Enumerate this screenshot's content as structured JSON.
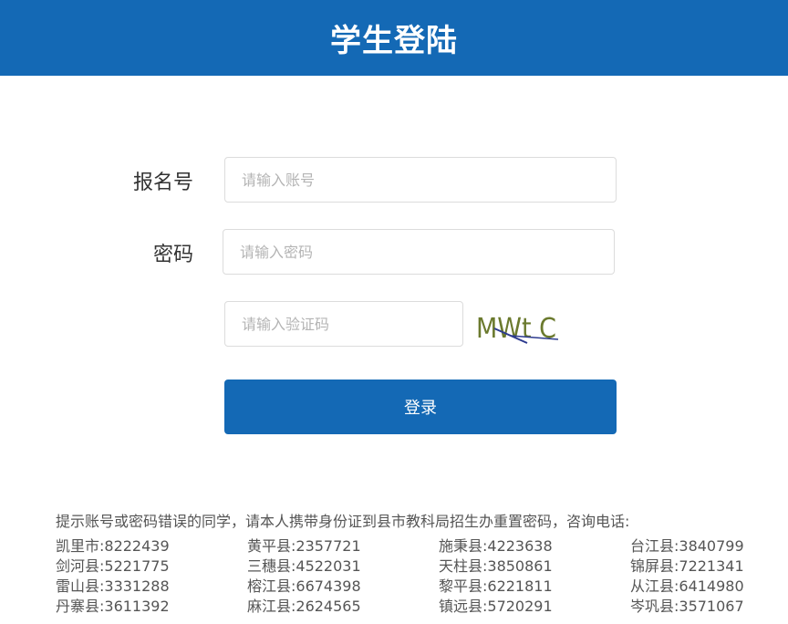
{
  "header": {
    "title": "学生登陆"
  },
  "form": {
    "account_label": "报名号",
    "account_placeholder": "请输入账号",
    "password_label": "密码",
    "password_placeholder": "请输入密码",
    "captcha_placeholder": "请输入验证码",
    "captcha_text": "MWt C",
    "login_label": "登录"
  },
  "footer": {
    "notice": "提示账号或密码错误的同学，请本人携带身份证到县市教科局招生办重置密码，咨询电话:",
    "contacts": [
      "凯里市:8222439",
      "黄平县:2357721",
      "施秉县:4223638",
      "台江县:3840799",
      "剑河县:5221775",
      "三穗县:4522031",
      "天柱县:3850861",
      "锦屏县:7221341",
      "雷山县:3331288",
      "榕江县:6674398",
      "黎平县:6221811",
      "从江县:6414980",
      "丹寨县:3611392",
      "麻江县:2624565",
      "镇远县:5720291",
      "岑巩县:3571067"
    ]
  },
  "colors": {
    "primary": "#1469b5",
    "captcha_text": "#6b7a2e",
    "captcha_line": "#2d3b8f"
  }
}
